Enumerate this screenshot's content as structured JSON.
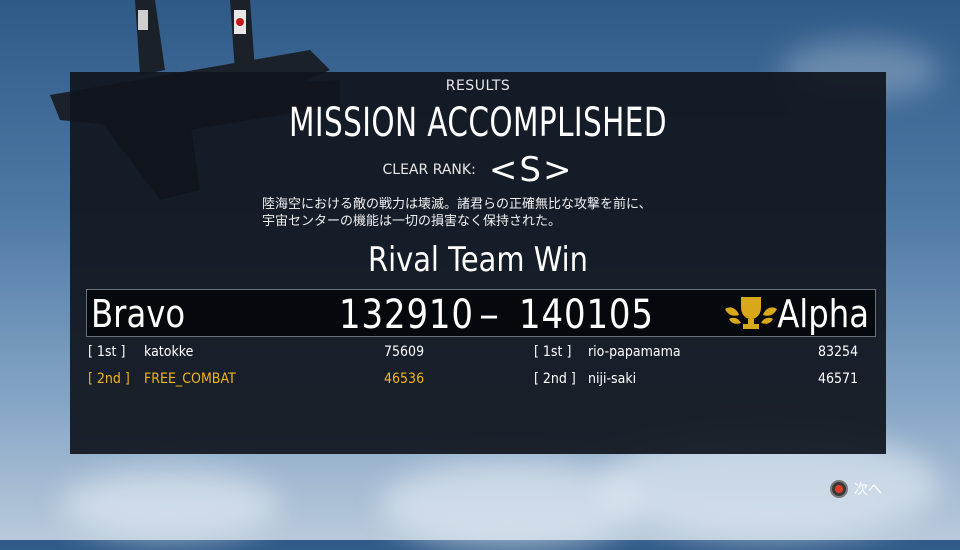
{
  "header": {
    "results_label": "RESULTS",
    "title": "MISSION ACCOMPLISHED",
    "clear_rank_label": "CLEAR RANK:",
    "clear_rank_value": "<S>"
  },
  "description": {
    "line1": "陸海空における敵の戦力は壊滅。諸君らの正確無比な攻撃を前に、",
    "line2": "宇宙センターの機能は一切の損害なく保持された。"
  },
  "outcome": "Rival Team Win",
  "scoreboard": {
    "left_team": "Bravo",
    "left_score": "132910",
    "separator": "–",
    "right_score": "140105",
    "right_team": "Alpha",
    "winner_icon": "trophy-icon"
  },
  "players": {
    "left": [
      {
        "place": "[ 1st ]",
        "name": "katokke",
        "score": "75609"
      },
      {
        "place": "[ 2nd ]",
        "name": "FREE_COMBAT",
        "score": "46536"
      }
    ],
    "right": [
      {
        "place": "[ 1st ]",
        "name": "rio-papamama",
        "score": "83254"
      },
      {
        "place": "[ 2nd ]",
        "name": "niji-saki",
        "score": "46571"
      }
    ]
  },
  "footer": {
    "next_label": "次へ",
    "button_icon": "circle-button-icon"
  },
  "colors": {
    "highlight": "#f3b519",
    "panel": "#10161e",
    "text": "#ffffff"
  }
}
